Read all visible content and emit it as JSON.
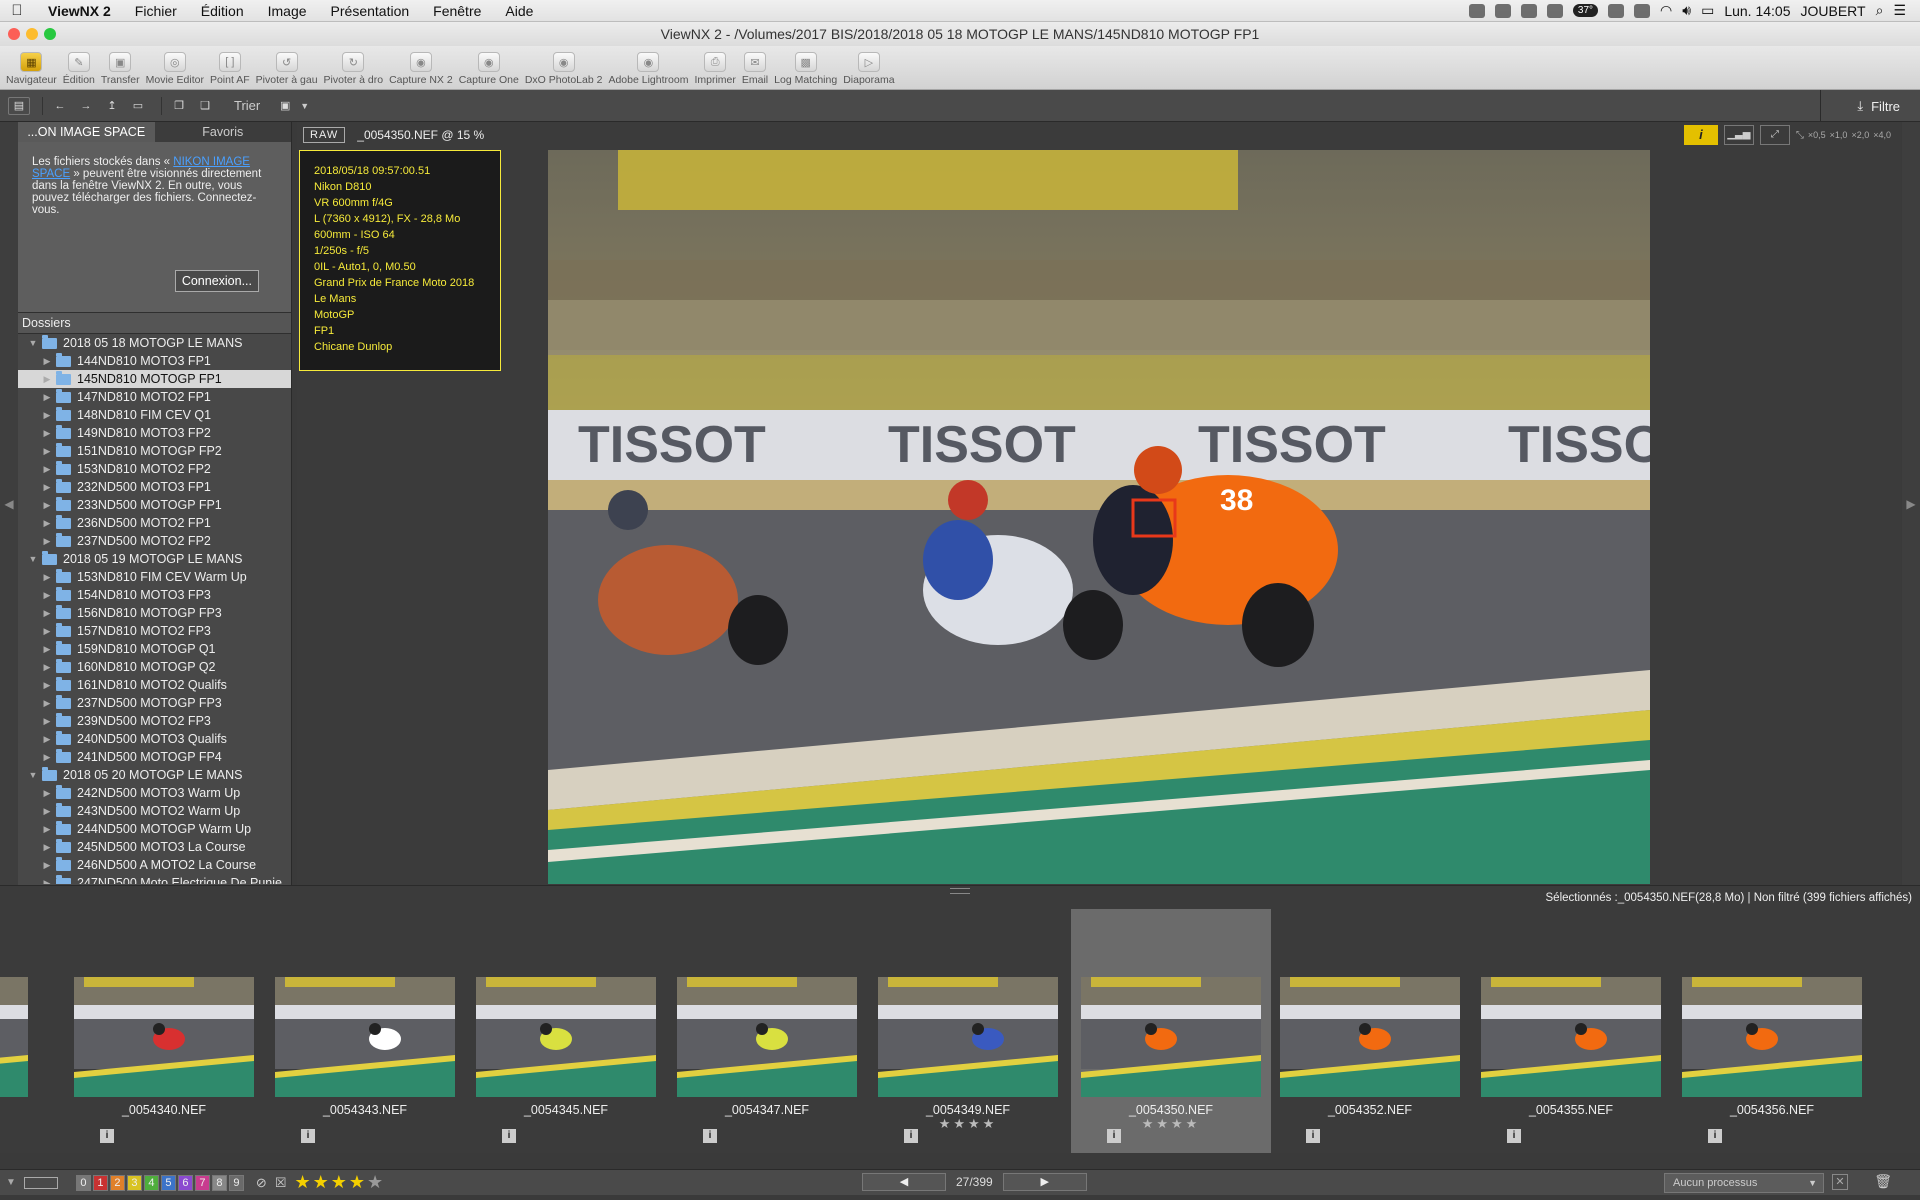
{
  "menubar": {
    "app_name": "ViewNX 2",
    "items": [
      "Fichier",
      "Édition",
      "Image",
      "Présentation",
      "Fenêtre",
      "Aide"
    ],
    "battery": "37°",
    "clock": "Lun. 14:05",
    "user": "JOUBERT"
  },
  "window": {
    "title": "ViewNX 2 - /Volumes/2017 BIS/2018/2018 05 18 MOTOGP LE MANS/145ND810 MOTOGP FP1"
  },
  "toolbar": {
    "items": [
      {
        "label": "Navigateur",
        "icon": "navigator-icon"
      },
      {
        "label": "Édition",
        "icon": "pencil-icon"
      },
      {
        "label": "Transfer",
        "icon": "camera-icon"
      },
      {
        "label": "Movie Editor",
        "icon": "film-icon"
      },
      {
        "label": "Point AF",
        "icon": "af-point-icon"
      },
      {
        "label": "Pivoter à gau",
        "icon": "rotate-left-icon"
      },
      {
        "label": "Pivoter à dro",
        "icon": "rotate-right-icon"
      },
      {
        "label": "Capture NX 2",
        "icon": "app-icon"
      },
      {
        "label": "Capture One",
        "icon": "app-icon"
      },
      {
        "label": "DxO PhotoLab 2",
        "icon": "app-icon"
      },
      {
        "label": "Adobe Lightroom",
        "icon": "app-icon"
      },
      {
        "label": "Imprimer",
        "icon": "printer-icon"
      },
      {
        "label": "Email",
        "icon": "envelope-icon"
      },
      {
        "label": "Log Matching",
        "icon": "map-icon"
      },
      {
        "label": "Diaporama",
        "icon": "slideshow-icon"
      }
    ]
  },
  "subbar": {
    "sort_label": "Trier",
    "filter_label": "Filtre"
  },
  "left_panel": {
    "tabs": [
      "...ON IMAGE SPACE",
      "Favoris"
    ],
    "nis_text_before": "Les fichiers stockés dans « ",
    "nis_link": "NIKON IMAGE SPACE",
    "nis_text_after": " » peuvent être visionnés directement dans la fenêtre ViewNX 2. En outre, vous pouvez télécharger des fichiers. Connectez-vous.",
    "connect_button": "Connexion...",
    "folders_header": "Dossiers",
    "tree": [
      {
        "label": "2018 05 18 MOTOGP LE MANS",
        "level": 0,
        "open": true
      },
      {
        "label": "144ND810 MOTO3 FP1",
        "level": 1
      },
      {
        "label": "145ND810 MOTOGP FP1",
        "level": 1,
        "selected": true
      },
      {
        "label": "147ND810 MOTO2 FP1",
        "level": 1
      },
      {
        "label": "148ND810 FIM CEV Q1",
        "level": 1
      },
      {
        "label": "149ND810 MOTO3 FP2",
        "level": 1
      },
      {
        "label": "151ND810 MOTOGP FP2",
        "level": 1
      },
      {
        "label": "153ND810 MOTO2 FP2",
        "level": 1
      },
      {
        "label": "232ND500 MOTO3 FP1",
        "level": 1
      },
      {
        "label": "233ND500 MOTOGP FP1",
        "level": 1
      },
      {
        "label": "236ND500 MOTO2 FP1",
        "level": 1
      },
      {
        "label": "237ND500 MOTO2 FP2",
        "level": 1
      },
      {
        "label": "2018 05 19 MOTOGP LE MANS",
        "level": 0,
        "open": true
      },
      {
        "label": "153ND810 FIM CEV Warm Up",
        "level": 1
      },
      {
        "label": "154ND810 MOTO3 FP3",
        "level": 1
      },
      {
        "label": "156ND810 MOTOGP FP3",
        "level": 1
      },
      {
        "label": "157ND810 MOTO2 FP3",
        "level": 1
      },
      {
        "label": "159ND810 MOTOGP Q1",
        "level": 1
      },
      {
        "label": "160ND810 MOTOGP Q2",
        "level": 1
      },
      {
        "label": "161ND810 MOTO2 Qualifs",
        "level": 1
      },
      {
        "label": "237ND500 MOTOGP FP3",
        "level": 1
      },
      {
        "label": "239ND500 MOTO2 FP3",
        "level": 1
      },
      {
        "label": "240ND500 MOTO3 Qualifs",
        "level": 1
      },
      {
        "label": "241ND500 MOTOGP FP4",
        "level": 1
      },
      {
        "label": "2018 05 20 MOTOGP LE MANS",
        "level": 0,
        "open": true
      },
      {
        "label": "242ND500 MOTO3 Warm Up",
        "level": 1
      },
      {
        "label": "243ND500 MOTO2 Warm Up",
        "level": 1
      },
      {
        "label": "244ND500 MOTOGP Warm Up",
        "level": 1
      },
      {
        "label": "245ND500 MOTO3 La Course",
        "level": 1
      },
      {
        "label": "246ND500 A MOTO2 La Course",
        "level": 1
      },
      {
        "label": "247ND500 Moto Electrique De Punie",
        "level": 1
      }
    ]
  },
  "viewer": {
    "raw_badge": "RAW",
    "filename_zoom": "_0054350.NEF @ 15 %",
    "info_icon": "i",
    "zoom_levels": [
      "×0,5",
      "×1,0",
      "×2,0",
      "×4,0"
    ],
    "info_lines": [
      "2018/05/18 09:57:00.51",
      "Nikon D810",
      "VR 600mm f/4G",
      "L (7360 x 4912), FX - 28,8 Mo",
      "600mm - ISO 64",
      "1/250s - f/5",
      "0IL - Auto1, 0, M0.50",
      "Grand Prix de France Moto 2018",
      "Le Mans",
      "MotoGP",
      "FP1",
      "Chicane Dunlop"
    ],
    "photo_text": "TISSOT",
    "rider_number": "38"
  },
  "status": {
    "text": "Sélectionnés :_0054350.NEF(28,8 Mo) | Non filtré (399 fichiers affichés)"
  },
  "filmstrip": {
    "items": [
      {
        "name": "",
        "stars": ""
      },
      {
        "name": "_0054340.NEF",
        "stars": ""
      },
      {
        "name": "_0054343.NEF",
        "stars": ""
      },
      {
        "name": "_0054345.NEF",
        "stars": ""
      },
      {
        "name": "_0054347.NEF",
        "stars": ""
      },
      {
        "name": "_0054349.NEF",
        "stars": "★★★★"
      },
      {
        "name": "_0054350.NEF",
        "stars": "★★★★",
        "selected": true
      },
      {
        "name": "_0054352.NEF",
        "stars": ""
      },
      {
        "name": "_0054355.NEF",
        "stars": ""
      },
      {
        "name": "_0054356.NEF",
        "stars": ""
      }
    ],
    "info_icon": "i"
  },
  "bottombar": {
    "labels": [
      "0",
      "1",
      "2",
      "3",
      "4",
      "5",
      "6",
      "7",
      "8",
      "9"
    ],
    "label_colors": [
      "#777777",
      "#c83232",
      "#e0802a",
      "#d9c323",
      "#4fae3c",
      "#3c73c8",
      "#8b4ad0",
      "#c83c8f",
      "#888888",
      "#6a6a6a"
    ],
    "page": "27/399",
    "process_placeholder": "Aucun processus",
    "rating_stars": 4
  }
}
